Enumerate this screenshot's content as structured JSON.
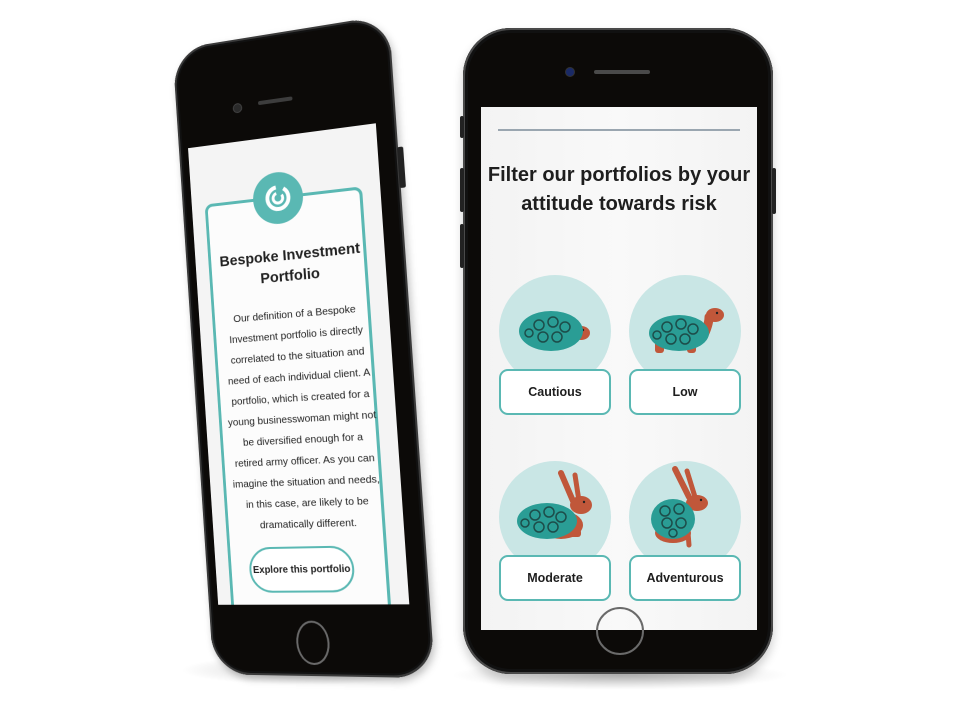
{
  "left_phone": {
    "card": {
      "logo_icon": "circular-portfolio-icon",
      "title": "Bespoke Investment Portfolio",
      "body": "Our definition of a Bespoke Investment portfolio is directly correlated to the situation and need of each individual client. A portfolio, which is created for a young businesswoman might not be diversified enough for a retired army officer. As you can imagine the situation and needs, in this case, are likely to be dramatically different.",
      "button_label": "Explore this portfolio"
    }
  },
  "right_phone": {
    "heading": "Filter our portfolios by your attitude towards risk",
    "risk_options": [
      {
        "label": "Cautious",
        "illustration": "tortoise-hidden-icon"
      },
      {
        "label": "Low",
        "illustration": "tortoise-walking-icon"
      },
      {
        "label": "Moderate",
        "illustration": "tortoise-hare-icon"
      },
      {
        "label": "Adventurous",
        "illustration": "hare-shell-icon"
      }
    ]
  },
  "colors": {
    "accent_teal": "#5ab8b3",
    "circle_bg": "#c9e6e5",
    "shell": "#2a9d95",
    "animal_body": "#c0573a",
    "phone_body": "#0c0a08"
  }
}
